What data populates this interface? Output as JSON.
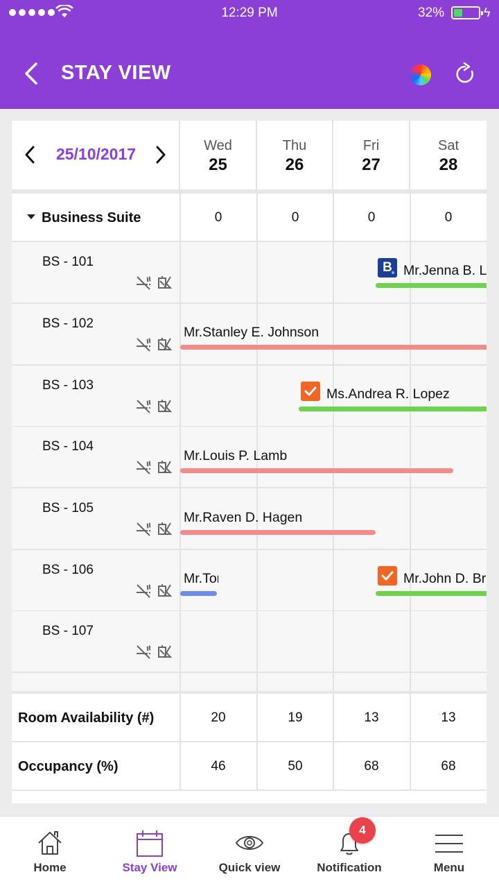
{
  "status_bar": {
    "time": "12:29 PM",
    "battery": "32%"
  },
  "header": {
    "title": "STAY VIEW"
  },
  "date_nav": {
    "date": "25/10/2017"
  },
  "days": [
    {
      "name": "Wed",
      "num": "25"
    },
    {
      "name": "Thu",
      "num": "26"
    },
    {
      "name": "Fri",
      "num": "27"
    },
    {
      "name": "Sat",
      "num": "28"
    }
  ],
  "category": {
    "name": "Business Suite",
    "counts": [
      "0",
      "0",
      "0",
      "0"
    ]
  },
  "rooms": [
    {
      "name": "BS - 101",
      "guest": "Mr.Jenna B. Lee",
      "bar_color": "#6ad44a",
      "badge": "B"
    },
    {
      "name": "BS - 102",
      "guest": "Mr.Stanley E. Johnson",
      "bar_color": "#f48b8b"
    },
    {
      "name": "BS - 103",
      "guest": "Ms.Andrea R. Lopez",
      "bar_color": "#6ad44a",
      "badge": "check"
    },
    {
      "name": "BS - 104",
      "guest": "Mr.Louis P. Lamb",
      "bar_color": "#f48b8b"
    },
    {
      "name": "BS - 105",
      "guest": "Mr.Raven D. Hagen",
      "bar_color": "#f48b8b"
    },
    {
      "name": "BS - 106",
      "guest": "Mr.Tom",
      "guest2": "Mr.John D. Brown",
      "bar_color": "#6e8cf0",
      "bar2_color": "#6ad44a",
      "badge": "check"
    },
    {
      "name": "BS - 107"
    }
  ],
  "summary": [
    {
      "label": "Room Availability (#)",
      "values": [
        "20",
        "19",
        "13",
        "13"
      ]
    },
    {
      "label": "Occupancy (%)",
      "values": [
        "46",
        "50",
        "68",
        "68"
      ]
    }
  ],
  "tabs": [
    {
      "label": "Home",
      "icon": "home-icon"
    },
    {
      "label": "Stay View",
      "icon": "calendar-icon"
    },
    {
      "label": "Quick view",
      "icon": "eye-icon"
    },
    {
      "label": "Notification",
      "icon": "bell-icon"
    },
    {
      "label": "Menu",
      "icon": "hamburger-icon"
    }
  ],
  "notification_count": "4",
  "colors": {
    "accent": "#8c3fd6",
    "checked_in": "#6ad44a",
    "reserved": "#f48b8b",
    "blocked": "#6e8cf0",
    "badge": "#e8424d"
  }
}
